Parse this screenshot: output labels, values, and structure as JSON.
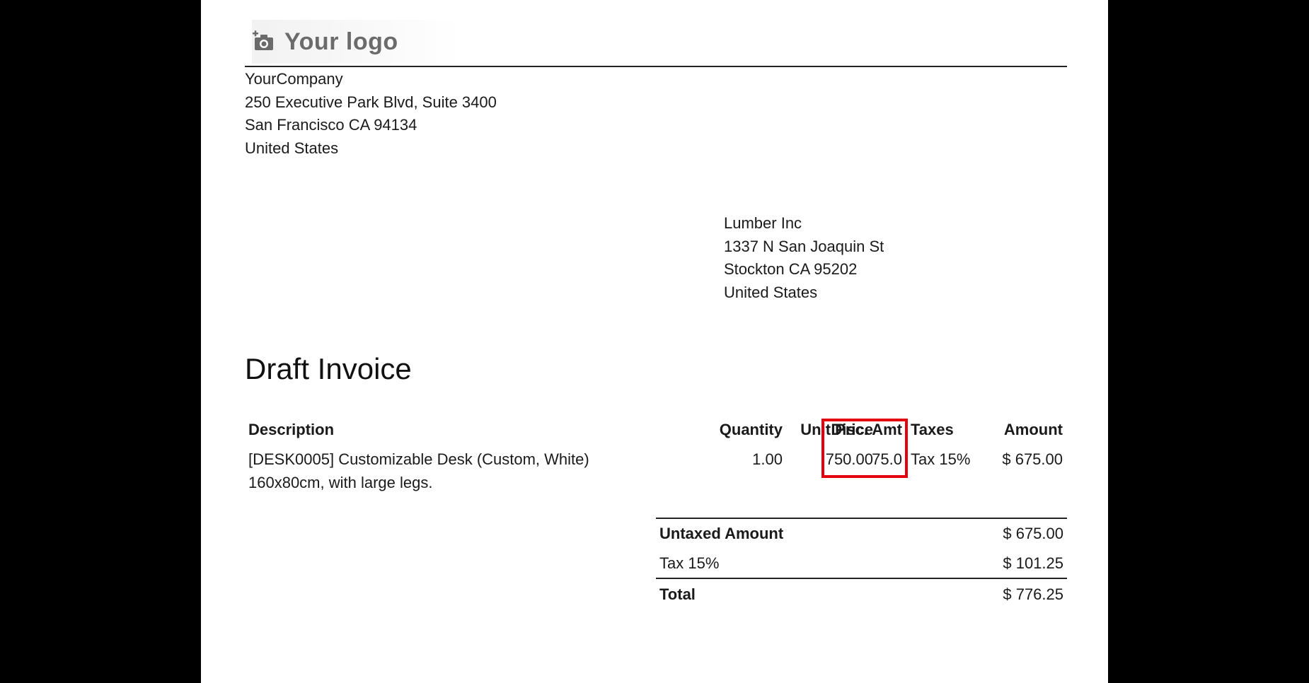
{
  "header": {
    "logo_text": "Your logo",
    "company": {
      "name": "YourCompany",
      "street": "250 Executive Park Blvd, Suite 3400",
      "city_line": "San Francisco CA 94134",
      "country": "United States"
    }
  },
  "customer": {
    "name": "Lumber Inc",
    "street": "1337 N San Joaquin St",
    "city_line": "Stockton CA 95202",
    "country": "United States"
  },
  "invoice": {
    "title": "Draft Invoice",
    "columns": {
      "description": "Description",
      "quantity": "Quantity",
      "unit_price": "Unit Price",
      "disc_amt": "Disc. Amt",
      "taxes": "Taxes",
      "amount": "Amount"
    },
    "lines": [
      {
        "description_line1": "[DESK0005] Customizable Desk (Custom, White)",
        "description_line2": "160x80cm, with large legs.",
        "quantity": "1.00",
        "unit_price": "750.00",
        "disc_amt": "75.0",
        "taxes": "Tax 15%",
        "amount": "$ 675.00"
      }
    ],
    "totals": {
      "untaxed_label": "Untaxed Amount",
      "untaxed_value": "$ 675.00",
      "tax_label": "Tax 15%",
      "tax_value": "$ 101.25",
      "total_label": "Total",
      "total_value": "$ 776.25"
    }
  },
  "colors": {
    "highlight": "#e3000f",
    "background": "#000000",
    "page": "#ffffff"
  }
}
